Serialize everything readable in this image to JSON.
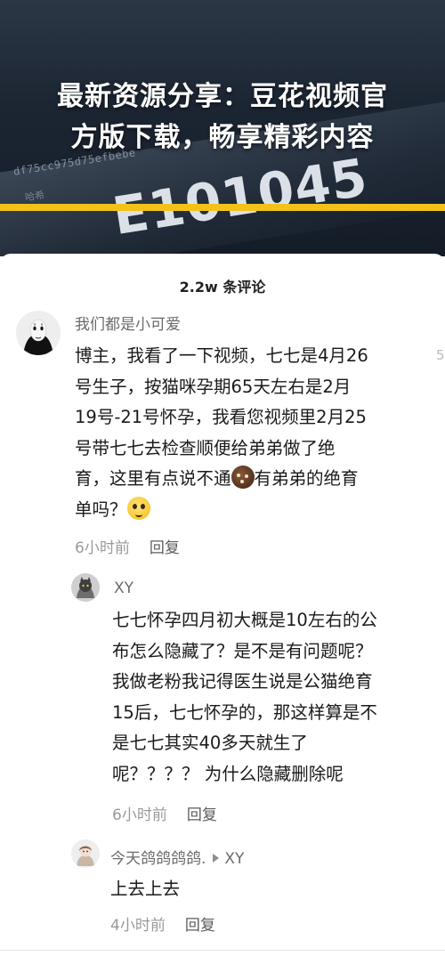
{
  "banner": {
    "headline_line1": "最新资源分享：豆花视频官",
    "headline_line2": "方版下载，畅享精彩内容",
    "bg_hash": "df75cc975d75efbebe",
    "bg_tag": "哈希",
    "bg_number": "E101045",
    "accent_color": "#f2c21a"
  },
  "sheet": {
    "title": "2.2w 条评论"
  },
  "comments": [
    {
      "username": "我们都是小可爱",
      "avatar_icon": "no-face-avatar-icon",
      "lines": [
        "博主，我看了一下视频，七七是4月26",
        "号生子，按猫咪孕期65天左右是2月",
        "19号-21号怀孕，我看您视频里2月25",
        "号带七七去检查顺便给弟弟做了绝",
        "育，这里有点说不通",
        "有弟弟的绝育",
        "单吗？"
      ],
      "time": "6小时前",
      "reply_label": "回复"
    },
    {
      "username": "XY",
      "avatar_icon": "cat-avatar-icon",
      "lines": [
        "七七怀孕四月初大概是10左右的公",
        "布怎么隐藏了？是不是有问题呢？",
        "我做老粉我记得医生说是公猫绝育",
        "15后，七七怀孕的，那这样算是不",
        "是七七其实40多天就生了",
        "呢？？？？ 为什么隐藏删除呢"
      ],
      "time": "6小时前",
      "reply_label": "回复"
    },
    {
      "username": "今天鸽鸽鸽鸽.",
      "reply_to": "XY",
      "avatar_icon": "girl-avatar-icon",
      "lines": [
        "上去上去"
      ],
      "time": "4小时前",
      "reply_label": "回复"
    }
  ],
  "edge_mark": "5"
}
